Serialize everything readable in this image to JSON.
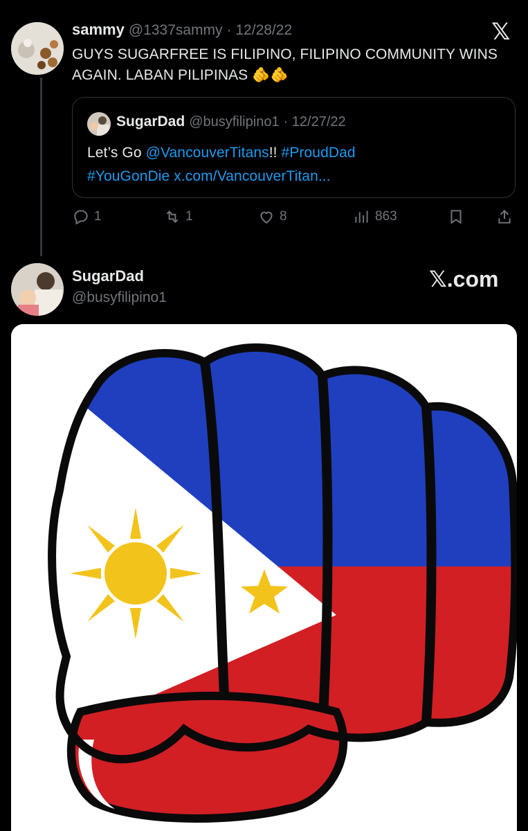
{
  "tweet": {
    "author_name": "sammy",
    "author_handle": "@1337sammy",
    "date": "· 12/28/22",
    "text": "GUYS SUGARFREE IS FILIPINO, FILIPINO COMMUNITY WINS AGAIN. LABAN PILIPINAS",
    "emoji": "🫵🫵",
    "x_logo": "𝕏"
  },
  "quote": {
    "author_name": "SugarDad",
    "author_handle": "@busyfilipino1",
    "date": "· 12/27/22",
    "text_prefix": "Let’s Go ",
    "mention": "@VancouverTitans",
    "text_mid": "!! ",
    "hashtag1": "#ProudDad",
    "hashtag2": "#YouGonDie",
    "url": "x.com/VancouverTitan..."
  },
  "actions": {
    "replies": "1",
    "retweets": "1",
    "likes": "8",
    "views": "863"
  },
  "embed": {
    "author_name": "SugarDad",
    "author_handle": "@busyfilipino1",
    "brand": "𝕏.com"
  },
  "colors": {
    "background": "#000000",
    "link": "#1d9bf0",
    "muted": "#71767b",
    "flag_blue": "#1f3fbf",
    "flag_red": "#d11f24",
    "flag_yellow": "#f2c31b"
  }
}
